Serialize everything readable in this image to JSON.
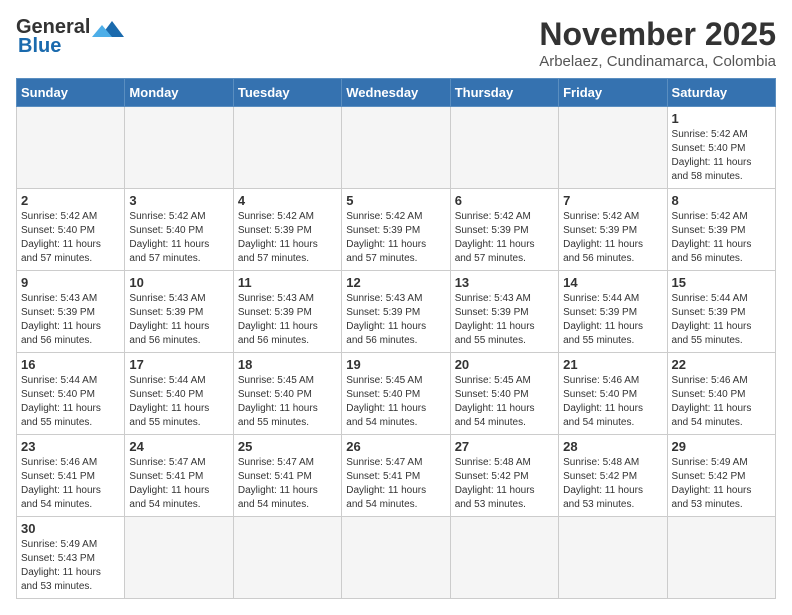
{
  "header": {
    "logo_line1": "General",
    "logo_line2": "Blue",
    "title": "November 2025",
    "subtitle": "Arbelaez, Cundinamarca, Colombia"
  },
  "weekdays": [
    "Sunday",
    "Monday",
    "Tuesday",
    "Wednesday",
    "Thursday",
    "Friday",
    "Saturday"
  ],
  "weeks": [
    [
      {
        "day": "",
        "info": ""
      },
      {
        "day": "",
        "info": ""
      },
      {
        "day": "",
        "info": ""
      },
      {
        "day": "",
        "info": ""
      },
      {
        "day": "",
        "info": ""
      },
      {
        "day": "",
        "info": ""
      },
      {
        "day": "1",
        "info": "Sunrise: 5:42 AM\nSunset: 5:40 PM\nDaylight: 11 hours\nand 58 minutes."
      }
    ],
    [
      {
        "day": "2",
        "info": "Sunrise: 5:42 AM\nSunset: 5:40 PM\nDaylight: 11 hours\nand 57 minutes."
      },
      {
        "day": "3",
        "info": "Sunrise: 5:42 AM\nSunset: 5:40 PM\nDaylight: 11 hours\nand 57 minutes."
      },
      {
        "day": "4",
        "info": "Sunrise: 5:42 AM\nSunset: 5:39 PM\nDaylight: 11 hours\nand 57 minutes."
      },
      {
        "day": "5",
        "info": "Sunrise: 5:42 AM\nSunset: 5:39 PM\nDaylight: 11 hours\nand 57 minutes."
      },
      {
        "day": "6",
        "info": "Sunrise: 5:42 AM\nSunset: 5:39 PM\nDaylight: 11 hours\nand 57 minutes."
      },
      {
        "day": "7",
        "info": "Sunrise: 5:42 AM\nSunset: 5:39 PM\nDaylight: 11 hours\nand 56 minutes."
      },
      {
        "day": "8",
        "info": "Sunrise: 5:42 AM\nSunset: 5:39 PM\nDaylight: 11 hours\nand 56 minutes."
      }
    ],
    [
      {
        "day": "9",
        "info": "Sunrise: 5:43 AM\nSunset: 5:39 PM\nDaylight: 11 hours\nand 56 minutes."
      },
      {
        "day": "10",
        "info": "Sunrise: 5:43 AM\nSunset: 5:39 PM\nDaylight: 11 hours\nand 56 minutes."
      },
      {
        "day": "11",
        "info": "Sunrise: 5:43 AM\nSunset: 5:39 PM\nDaylight: 11 hours\nand 56 minutes."
      },
      {
        "day": "12",
        "info": "Sunrise: 5:43 AM\nSunset: 5:39 PM\nDaylight: 11 hours\nand 56 minutes."
      },
      {
        "day": "13",
        "info": "Sunrise: 5:43 AM\nSunset: 5:39 PM\nDaylight: 11 hours\nand 55 minutes."
      },
      {
        "day": "14",
        "info": "Sunrise: 5:44 AM\nSunset: 5:39 PM\nDaylight: 11 hours\nand 55 minutes."
      },
      {
        "day": "15",
        "info": "Sunrise: 5:44 AM\nSunset: 5:39 PM\nDaylight: 11 hours\nand 55 minutes."
      }
    ],
    [
      {
        "day": "16",
        "info": "Sunrise: 5:44 AM\nSunset: 5:40 PM\nDaylight: 11 hours\nand 55 minutes."
      },
      {
        "day": "17",
        "info": "Sunrise: 5:44 AM\nSunset: 5:40 PM\nDaylight: 11 hours\nand 55 minutes."
      },
      {
        "day": "18",
        "info": "Sunrise: 5:45 AM\nSunset: 5:40 PM\nDaylight: 11 hours\nand 55 minutes."
      },
      {
        "day": "19",
        "info": "Sunrise: 5:45 AM\nSunset: 5:40 PM\nDaylight: 11 hours\nand 54 minutes."
      },
      {
        "day": "20",
        "info": "Sunrise: 5:45 AM\nSunset: 5:40 PM\nDaylight: 11 hours\nand 54 minutes."
      },
      {
        "day": "21",
        "info": "Sunrise: 5:46 AM\nSunset: 5:40 PM\nDaylight: 11 hours\nand 54 minutes."
      },
      {
        "day": "22",
        "info": "Sunrise: 5:46 AM\nSunset: 5:40 PM\nDaylight: 11 hours\nand 54 minutes."
      }
    ],
    [
      {
        "day": "23",
        "info": "Sunrise: 5:46 AM\nSunset: 5:41 PM\nDaylight: 11 hours\nand 54 minutes."
      },
      {
        "day": "24",
        "info": "Sunrise: 5:47 AM\nSunset: 5:41 PM\nDaylight: 11 hours\nand 54 minutes."
      },
      {
        "day": "25",
        "info": "Sunrise: 5:47 AM\nSunset: 5:41 PM\nDaylight: 11 hours\nand 54 minutes."
      },
      {
        "day": "26",
        "info": "Sunrise: 5:47 AM\nSunset: 5:41 PM\nDaylight: 11 hours\nand 54 minutes."
      },
      {
        "day": "27",
        "info": "Sunrise: 5:48 AM\nSunset: 5:42 PM\nDaylight: 11 hours\nand 53 minutes."
      },
      {
        "day": "28",
        "info": "Sunrise: 5:48 AM\nSunset: 5:42 PM\nDaylight: 11 hours\nand 53 minutes."
      },
      {
        "day": "29",
        "info": "Sunrise: 5:49 AM\nSunset: 5:42 PM\nDaylight: 11 hours\nand 53 minutes."
      }
    ],
    [
      {
        "day": "30",
        "info": "Sunrise: 5:49 AM\nSunset: 5:43 PM\nDaylight: 11 hours\nand 53 minutes."
      },
      {
        "day": "",
        "info": ""
      },
      {
        "day": "",
        "info": ""
      },
      {
        "day": "",
        "info": ""
      },
      {
        "day": "",
        "info": ""
      },
      {
        "day": "",
        "info": ""
      },
      {
        "day": "",
        "info": ""
      }
    ]
  ]
}
